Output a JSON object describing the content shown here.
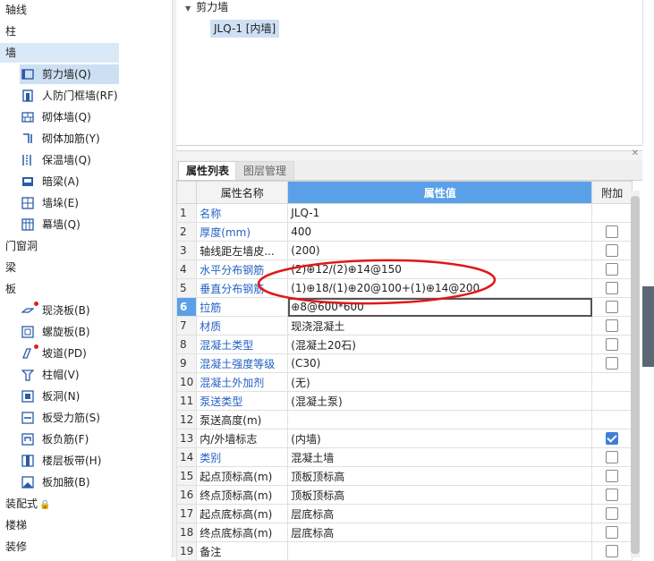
{
  "nav": {
    "categories": [
      {
        "label": "轴线"
      },
      {
        "label": "柱"
      },
      {
        "label": "墙"
      },
      {
        "label": "门窗洞"
      },
      {
        "label": "梁"
      },
      {
        "label": "板"
      },
      {
        "label": "装配式"
      },
      {
        "label": "楼梯"
      },
      {
        "label": "装修"
      }
    ],
    "wall_items": [
      {
        "label": "剪力墙(Q)",
        "icon": "shear-wall-icon"
      },
      {
        "label": "人防门框墙(RF)",
        "icon": "civil-defense-door-frame-wall-icon"
      },
      {
        "label": "砌体墙(Q)",
        "icon": "masonry-wall-icon"
      },
      {
        "label": "砌体加筋(Y)",
        "icon": "masonry-reinforcement-icon"
      },
      {
        "label": "保温墙(Q)",
        "icon": "insulation-wall-icon"
      },
      {
        "label": "暗梁(A)",
        "icon": "hidden-beam-icon"
      },
      {
        "label": "墙垛(E)",
        "icon": "wall-pier-icon"
      },
      {
        "label": "幕墙(Q)",
        "icon": "curtain-wall-icon"
      }
    ],
    "slab_items": [
      {
        "label": "现浇板(B)",
        "icon": "cast-slab-icon"
      },
      {
        "label": "螺旋板(B)",
        "icon": "spiral-slab-icon"
      },
      {
        "label": "坡道(PD)",
        "icon": "ramp-icon"
      },
      {
        "label": "柱帽(V)",
        "icon": "column-cap-icon"
      },
      {
        "label": "板洞(N)",
        "icon": "slab-hole-icon"
      },
      {
        "label": "板受力筋(S)",
        "icon": "slab-main-rebar-icon"
      },
      {
        "label": "板负筋(F)",
        "icon": "slab-negative-rebar-icon"
      },
      {
        "label": "楼层板带(H)",
        "icon": "floor-slab-band-icon"
      },
      {
        "label": "板加腋(B)",
        "icon": "slab-haunch-icon"
      }
    ]
  },
  "tree": {
    "root": "剪力墙",
    "item": "JLQ-1 [内墙]"
  },
  "props": {
    "tabs": [
      "属性列表",
      "图层管理"
    ],
    "headers": {
      "name": "属性名称",
      "value": "属性值",
      "extra": "附加"
    },
    "accent": "#5aa0e8",
    "rows": [
      {
        "num": "1",
        "name": "名称",
        "value": "JLQ-1",
        "blue": true,
        "check": "none"
      },
      {
        "num": "2",
        "name": "厚度(mm)",
        "value": "400",
        "blue": true,
        "check": "off"
      },
      {
        "num": "3",
        "name": "轴线距左墙皮...",
        "value": "(200)",
        "blue": false,
        "check": "off"
      },
      {
        "num": "4",
        "name": "水平分布钢筋",
        "value": "(2)⊕12/(2)⊕14@150",
        "blue": true,
        "check": "off"
      },
      {
        "num": "5",
        "name": "垂直分布钢筋",
        "value": "(1)⊕18/(1)⊕20@100+(1)⊕14@200",
        "blue": true,
        "check": "off"
      },
      {
        "num": "6",
        "name": "拉筋",
        "value": "⊕8@600*600",
        "blue": true,
        "check": "off",
        "current": true
      },
      {
        "num": "7",
        "name": "材质",
        "value": "现浇混凝土",
        "blue": true,
        "check": "off"
      },
      {
        "num": "8",
        "name": "混凝土类型",
        "value": "(混凝土20石)",
        "blue": true,
        "check": "off"
      },
      {
        "num": "9",
        "name": "混凝土强度等级",
        "value": "(C30)",
        "blue": true,
        "check": "off"
      },
      {
        "num": "10",
        "name": "混凝土外加剂",
        "value": "(无)",
        "blue": true,
        "check": "none"
      },
      {
        "num": "11",
        "name": "泵送类型",
        "value": "(混凝土泵)",
        "blue": true,
        "check": "none"
      },
      {
        "num": "12",
        "name": "泵送高度(m)",
        "value": "",
        "blue": false,
        "check": "none"
      },
      {
        "num": "13",
        "name": "内/外墙标志",
        "value": "(内墙)",
        "blue": false,
        "check": "on"
      },
      {
        "num": "14",
        "name": "类别",
        "value": "混凝土墙",
        "blue": true,
        "check": "off"
      },
      {
        "num": "15",
        "name": "起点顶标高(m)",
        "value": "顶板顶标高",
        "blue": false,
        "check": "off"
      },
      {
        "num": "16",
        "name": "终点顶标高(m)",
        "value": "顶板顶标高",
        "blue": false,
        "check": "off"
      },
      {
        "num": "17",
        "name": "起点底标高(m)",
        "value": "层底标高",
        "blue": false,
        "check": "off"
      },
      {
        "num": "18",
        "name": "终点底标高(m)",
        "value": "层底标高",
        "blue": false,
        "check": "off"
      },
      {
        "num": "19",
        "name": "备注",
        "value": "",
        "blue": false,
        "check": "off"
      }
    ]
  }
}
